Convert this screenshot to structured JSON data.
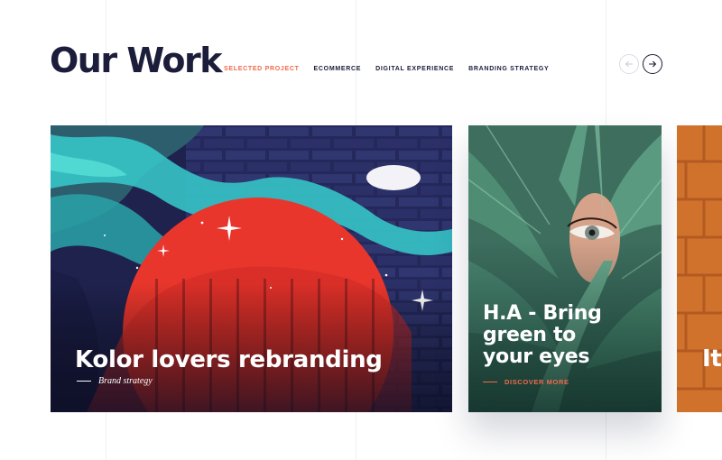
{
  "header": {
    "title": "Our Work",
    "filters": [
      {
        "label": "Selected Project",
        "active": true
      },
      {
        "label": "Ecommerce",
        "active": false
      },
      {
        "label": "Digital Experience",
        "active": false
      },
      {
        "label": "Branding Strategy",
        "active": false
      }
    ],
    "nav": {
      "prev_icon": "arrow-left-icon",
      "next_icon": "arrow-right-icon"
    }
  },
  "projects": [
    {
      "title": "Kolor lovers rebranding",
      "category": "Brand strategy",
      "image": "graffiti-brick-wall-image"
    },
    {
      "title_lines": [
        "H.A - Bring",
        "green to",
        "your eyes"
      ],
      "cta": "Discover more",
      "image": "leaf-eye-portrait-image"
    },
    {
      "title": "It’",
      "image": "orange-brick-wall-image"
    }
  ],
  "colors": {
    "accent": "#ef6a4c",
    "heading": "#1b1d3a",
    "grid": "#eef0f4"
  }
}
